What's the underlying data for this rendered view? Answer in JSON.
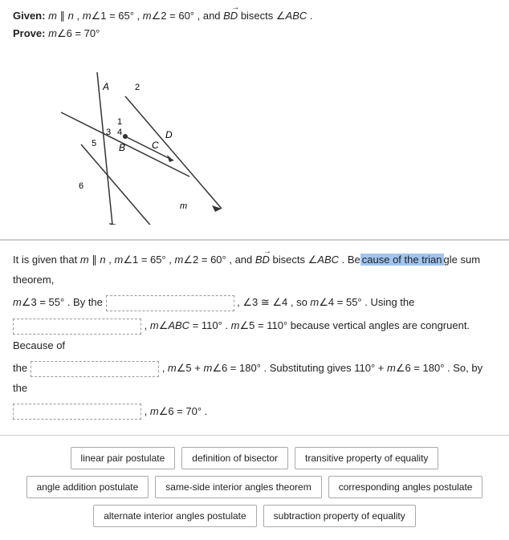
{
  "given": {
    "label": "Given:",
    "text": "m ∥ n , m∠1 = 65° , m∠2 = 60° , and BD bisects ∠ABC .",
    "italic_m": "m",
    "italic_n": "n"
  },
  "prove": {
    "label": "Prove:",
    "text": "m∠6 = 70°"
  },
  "proof": {
    "intro": "It is given that ",
    "intro_italic": "m ∥ n",
    "intro_rest": " , m∠1 = 65° , m∠2 = 60° , and ",
    "BD": "BD",
    "bisects": " bisects ∠ABC . Be",
    "highlight": "cause of the trian",
    "after_highlight": "gle sum theorem,",
    "line1_pre": "m∠3 = 55° . By the",
    "blank1": "",
    "line1_post": ", ∠3 ≅ ∠4 , so m∠4 = 55° . Using the",
    "blank2": "",
    "line2": ", m∠ABC = 110° . m∠5 = 110° because vertical angles are congruent. Because of",
    "the": "the",
    "blank3": "",
    "line3": ", m∠5 + m∠6 = 180° . Substituting gives 110° + m∠6 = 180° . So, by the",
    "blank4": "",
    "line4": ", m∠6 = 70° ."
  },
  "choices": [
    "linear pair postulate",
    "definition of bisector",
    "transitive property of equality",
    "angle addition postulate",
    "same-side interior angles theorem",
    "corresponding angles postulate",
    "alternate interior angles postulate",
    "subtraction property of equality"
  ]
}
